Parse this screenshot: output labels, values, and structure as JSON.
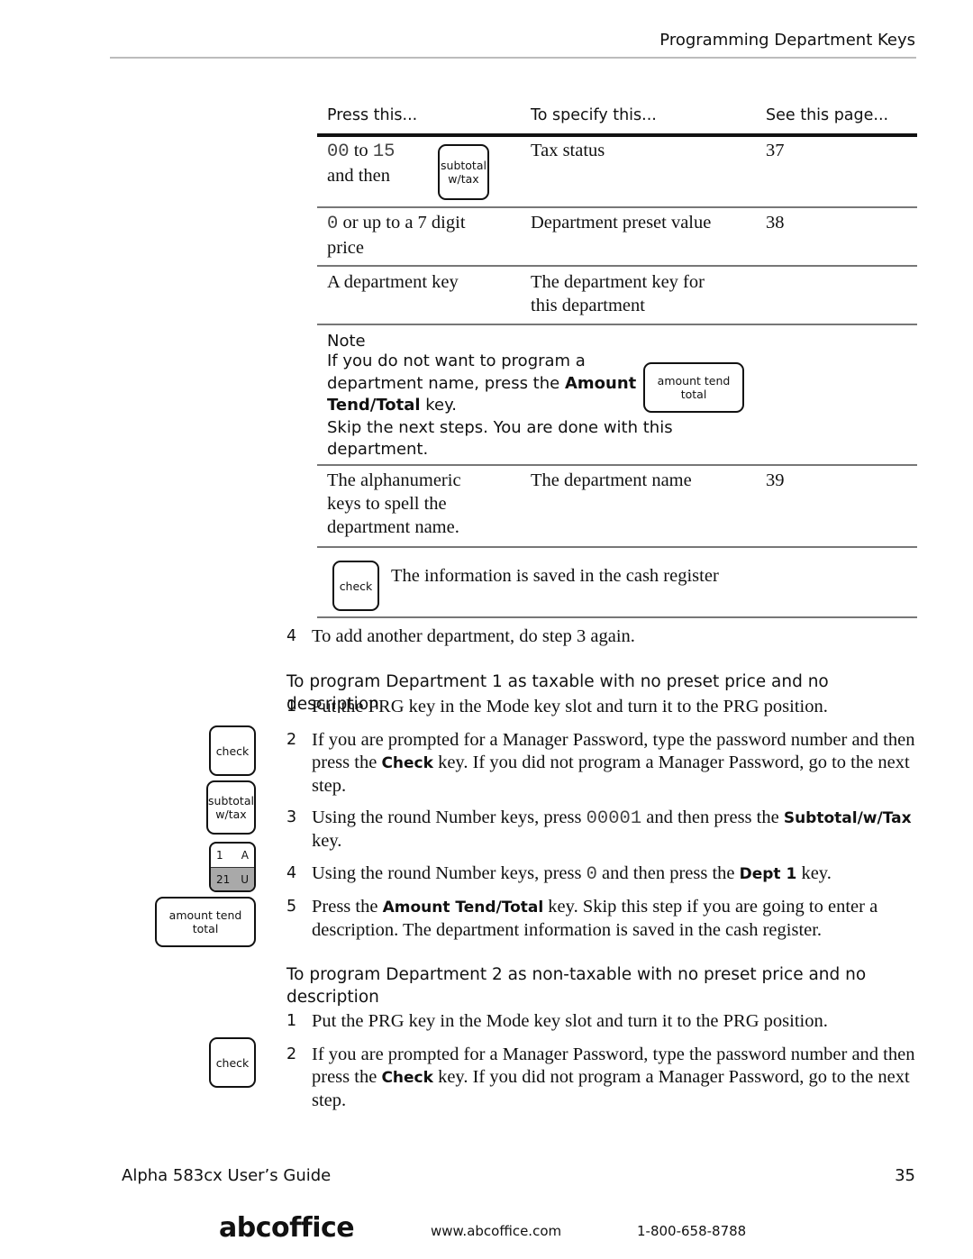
{
  "header": {
    "section_title": "Programming Department Keys"
  },
  "table": {
    "columns": [
      "Press this...",
      "To specify this...",
      "See this page..."
    ],
    "rows": [
      {
        "press_mono_a": "00",
        "press_to": " to ",
        "press_mono_b": "15",
        "press_line2": "and then",
        "key": {
          "line1": "subtotal",
          "line2": "w/tax"
        },
        "specify": "Tax status",
        "page": "37"
      },
      {
        "press_mono_a": "0",
        "press_rest": " or up to a 7 digit",
        "press_line2": "price",
        "specify": "Department preset value",
        "page": "38"
      },
      {
        "press": "A department key",
        "specify_line1": "The department key for",
        "specify_line2": "this department",
        "page": ""
      }
    ],
    "note": {
      "title": "Note",
      "line1": "If you do not want to program a",
      "line2_pre": "department name, press the ",
      "line2_bold": "Amount",
      "line3_bold": "Tend/Total",
      "line3_post": " key.",
      "line4": "Skip the next steps. You are done with this",
      "line5": "department.",
      "key": {
        "line1": "amount tend",
        "line2": "total"
      }
    },
    "row4": {
      "press_line1": "The alphanumeric",
      "press_line2": "keys to spell the",
      "press_line3": "department name.",
      "specify": "The department name",
      "page": "39"
    },
    "row5": {
      "key": "check",
      "text": "The information is saved in the cash register"
    }
  },
  "step4": {
    "num": "4",
    "text": "To add another department, do step 3 again."
  },
  "dept1": {
    "heading": "To program Department 1 as taxable with no preset price and no description",
    "steps": [
      {
        "num": "1",
        "text": "Put the PRG key in the Mode key slot and turn it to the PRG position."
      },
      {
        "num": "2",
        "pre": "If you are prompted for a Manager Password, type the password number and then press the ",
        "bold": "Check",
        "post": " key. If you did not program a Manager Password, go to the next step."
      },
      {
        "num": "3",
        "pre": "Using the round Number keys, press ",
        "mono": "00001",
        "mid": " and then press the ",
        "bold": "Subtotal/w/Tax",
        "post": " key."
      },
      {
        "num": "4",
        "pre": "Using the round Number keys, press ",
        "mono": "0",
        "mid": " and then press the ",
        "bold": "Dept 1",
        "post": " key."
      },
      {
        "num": "5",
        "pre": "Press the ",
        "bold": "Amount Tend/Total",
        "post": " key. Skip this step if you are going to enter a description. The department information is saved in the cash register."
      }
    ],
    "side_keys": {
      "check": "check",
      "subtotal_line1": "subtotal",
      "subtotal_line2": "w/tax",
      "dept_top_left": "1",
      "dept_top_right": "A",
      "dept_bottom_left": "21",
      "dept_bottom_right": "U",
      "amount_line1": "amount tend",
      "amount_line2": "total"
    }
  },
  "dept2": {
    "heading": "To program Department 2 as non-taxable with no preset price and no description",
    "steps": [
      {
        "num": "1",
        "text": "Put the PRG key in the Mode key slot and turn it to the PRG position."
      },
      {
        "num": "2",
        "pre": "If you are prompted for a Manager Password, type the password number and then press the ",
        "bold": "Check",
        "post": " key. If you did not program a Manager Password, go to the next step."
      }
    ],
    "side_keys": {
      "check": "check"
    }
  },
  "footer": {
    "guide_title": "Alpha 583cx  User’s Guide",
    "page_number": "35",
    "brand": "abcoffice",
    "url": "www.abcoffice.com",
    "phone": "1-800-658-8788"
  }
}
